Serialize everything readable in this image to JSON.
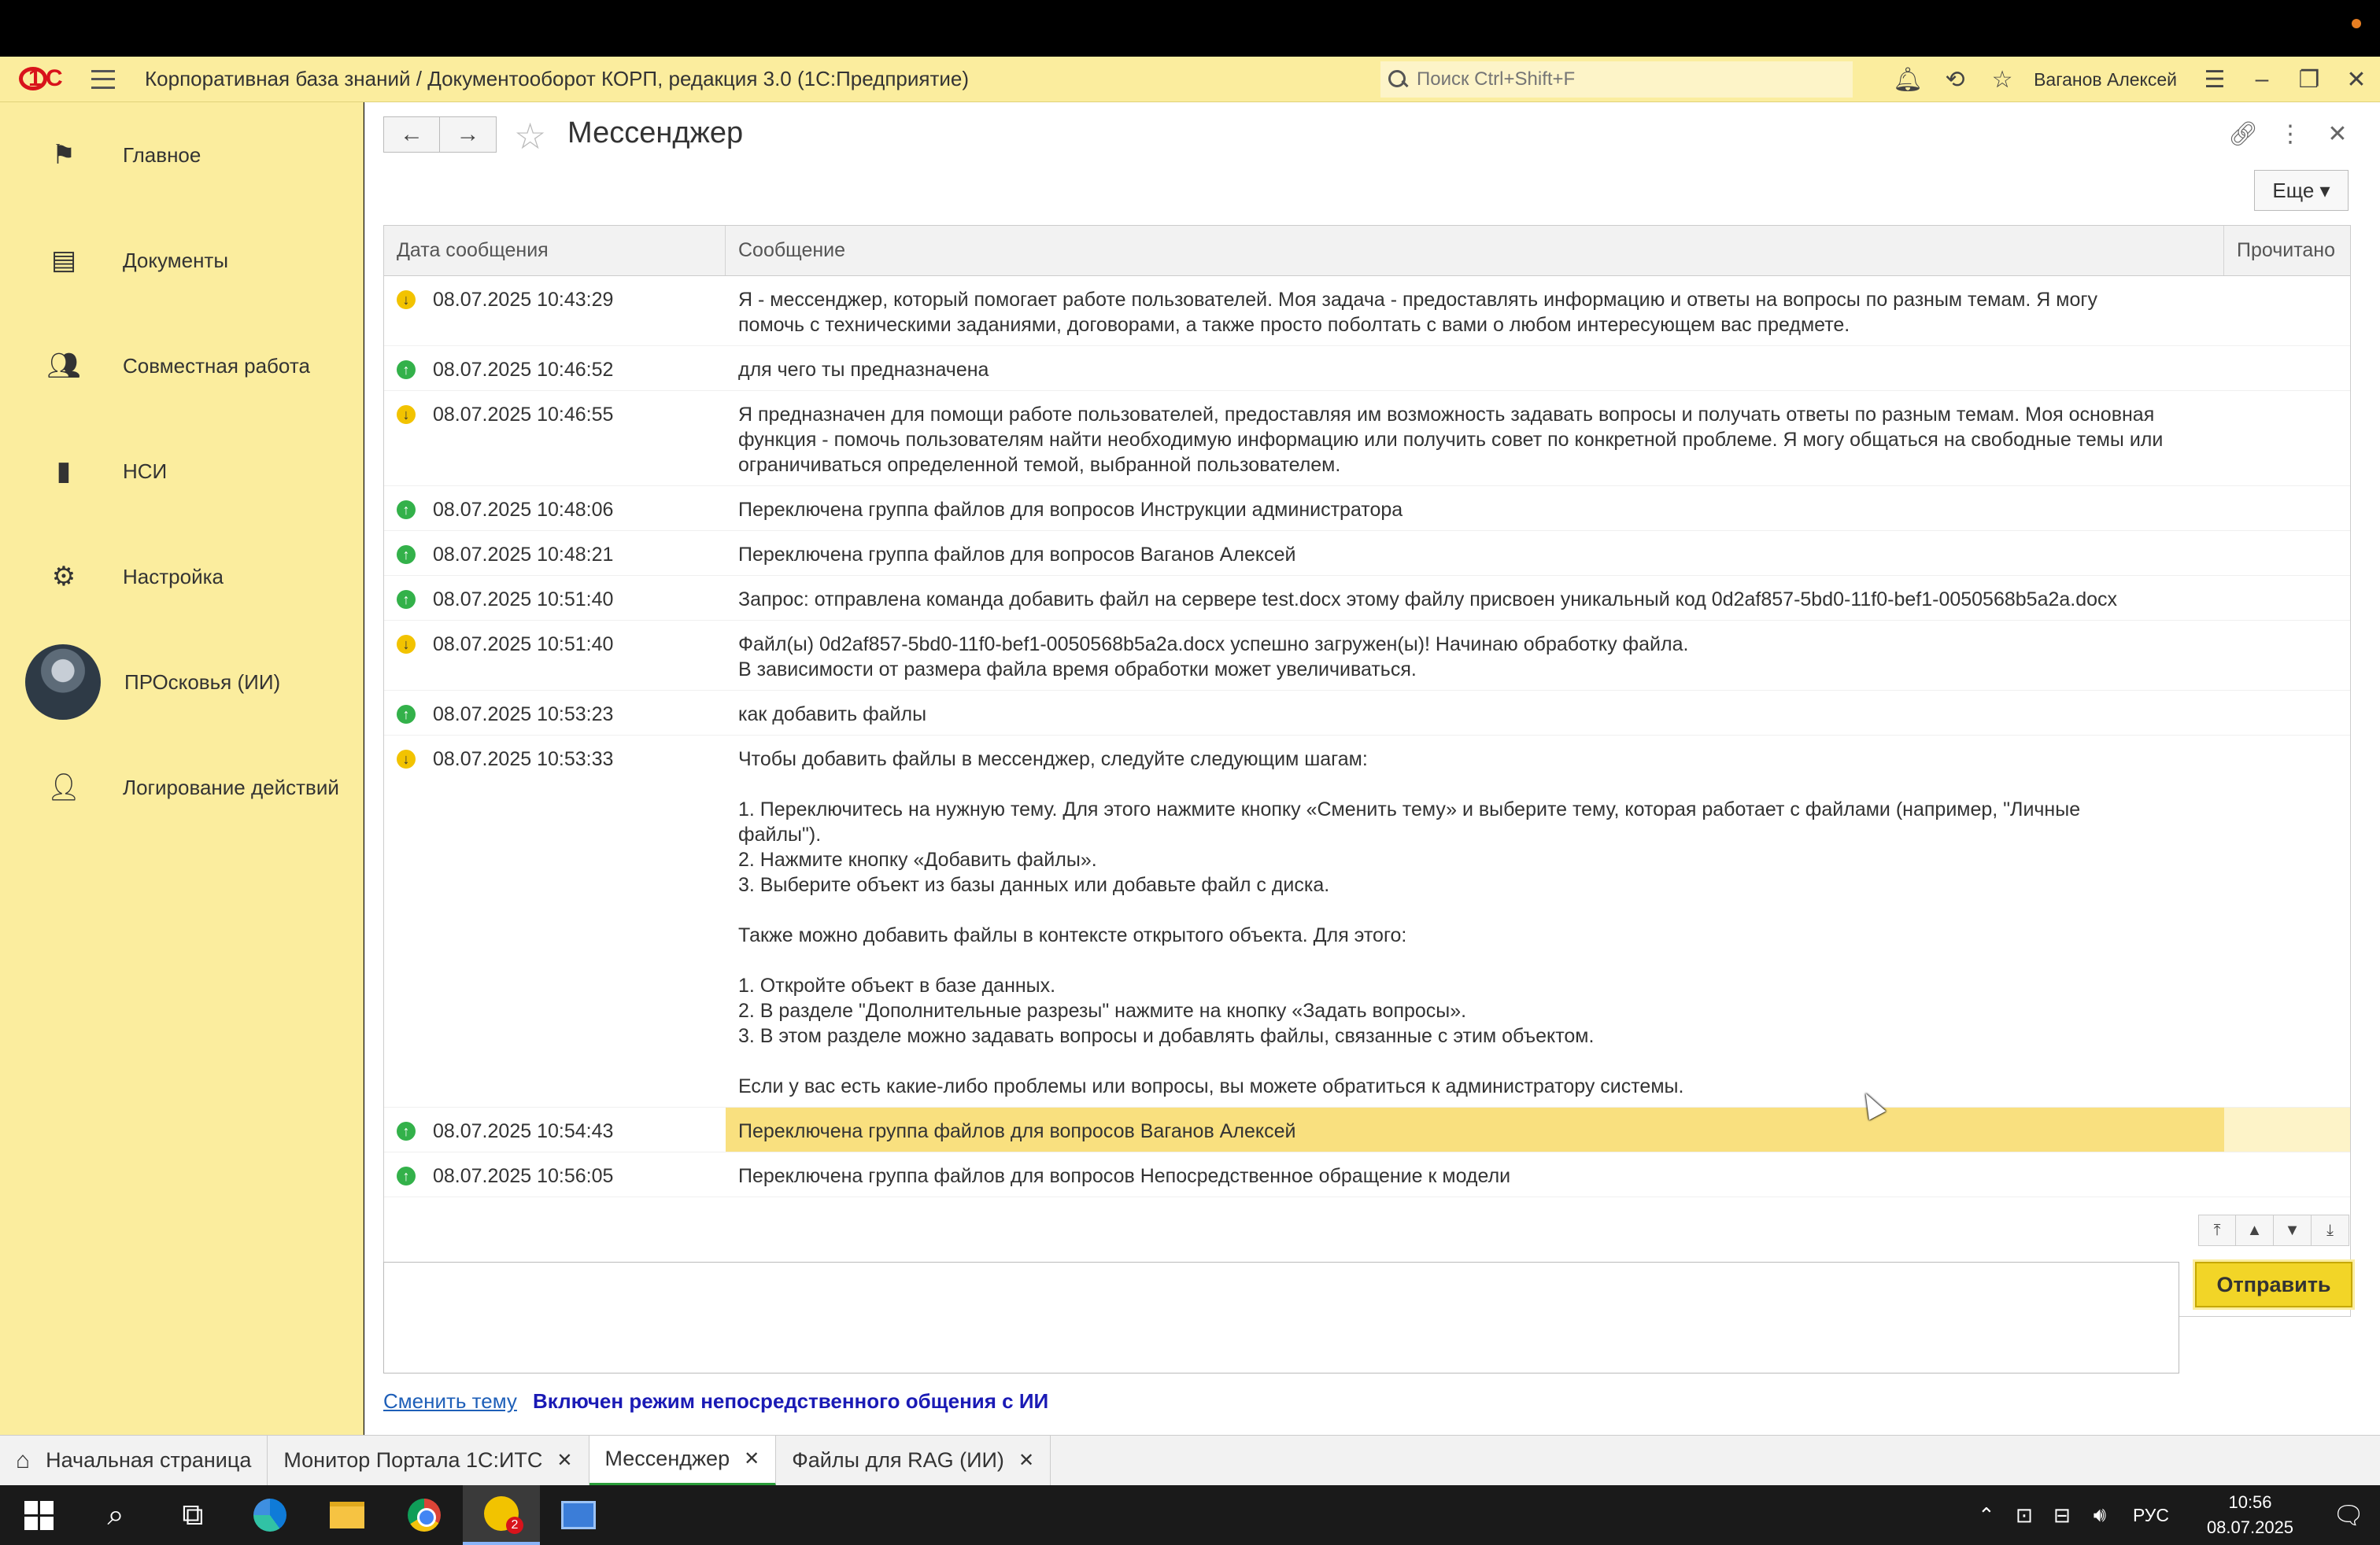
{
  "app": {
    "title": "Корпоративная база знаний / Документооборот КОРП, редакция 3.0  (1С:Предприятие)",
    "search_placeholder": "Поиск Ctrl+Shift+F",
    "user": "Ваганов Алексей"
  },
  "sidebar": {
    "items": [
      {
        "label": "Главное",
        "icon": "flag-icon"
      },
      {
        "label": "Документы",
        "icon": "documents-icon"
      },
      {
        "label": "Совместная работа",
        "icon": "people-icon"
      },
      {
        "label": "НСИ",
        "icon": "books-icon"
      },
      {
        "label": "Настройка",
        "icon": "gear-icon"
      },
      {
        "label": "ПРОсковья (ИИ)",
        "icon": "avatar"
      },
      {
        "label": "Логирование действий",
        "icon": "person-icon"
      }
    ]
  },
  "page": {
    "title": "Мессенджер",
    "more_label": "Еще"
  },
  "table": {
    "columns": [
      "Дата сообщения",
      "Сообщение",
      "Прочитано"
    ],
    "rows": [
      {
        "dir": "in",
        "date": "08.07.2025 10:43:29",
        "message": "Я - мессенджер, который помогает работе пользователей. Моя задача - предоставлять информацию и ответы на вопросы по разным темам. Я могу\nпомочь с техническими заданиями, договорами, а также просто поболтать с вами о любом интересующем вас предмете."
      },
      {
        "dir": "out",
        "date": "08.07.2025 10:46:52",
        "message": "для чего ты предназначена"
      },
      {
        "dir": "in",
        "date": "08.07.2025 10:46:55",
        "message": "Я предназначен для помощи работе пользователей, предоставляя им возможность задавать вопросы и получать ответы по разным темам. Моя основная\nфункция - помочь пользователям найти необходимую информацию или получить совет по конкретной проблеме. Я могу общаться на свободные темы или\nограничиваться определенной темой, выбранной пользователем."
      },
      {
        "dir": "out",
        "date": "08.07.2025 10:48:06",
        "message": "Переключена группа файлов для вопросов Инструкции администратора"
      },
      {
        "dir": "out",
        "date": "08.07.2025 10:48:21",
        "message": "Переключена группа файлов для вопросов Ваганов Алексей"
      },
      {
        "dir": "out",
        "date": "08.07.2025 10:51:40",
        "message": "Запрос: отправлена команда добавить файл на сервере test.docx этому файлу присвоен уникальный код 0d2af857-5bd0-11f0-bef1-0050568b5a2a.docx"
      },
      {
        "dir": "in",
        "date": "08.07.2025 10:51:40",
        "message": "Файл(ы) 0d2af857-5bd0-11f0-bef1-0050568b5a2a.docx успешно загружен(ы)! Начинаю обработку файла.\nВ зависимости от размера файла время обработки может увеличиваться."
      },
      {
        "dir": "out",
        "date": "08.07.2025 10:53:23",
        "message": "как добавить файлы"
      },
      {
        "dir": "in",
        "date": "08.07.2025 10:53:33",
        "message": "Чтобы добавить файлы в мессенджер, следуйте следующим шагам:\n\n1. Переключитесь на нужную тему. Для этого нажмите кнопку «Сменить тему» и выберите тему, которая работает с файлами (например, \"Личные\nфайлы\").\n2. Нажмите кнопку «Добавить файлы».\n3. Выберите объект из базы данных или добавьте файл с диска.\n\nТакже можно добавить файлы в контексте открытого объекта. Для этого:\n\n1. Откройте объект в базе данных.\n2. В разделе \"Дополнительные разрезы\" нажмите на кнопку «Задать вопросы».\n3. В этом разделе можно задавать вопросы и добавлять файлы, связанные с этим объектом.\n\nЕсли у вас есть какие-либо проблемы или вопросы, вы можете обратиться к администратору системы."
      },
      {
        "dir": "out",
        "date": "08.07.2025 10:54:43",
        "message": "Переключена группа файлов для вопросов Ваганов Алексей",
        "selected": true
      },
      {
        "dir": "out",
        "date": "08.07.2025 10:56:05",
        "message": "Переключена группа файлов для вопросов Непосредственное обращение к модели"
      }
    ]
  },
  "compose": {
    "send_label": "Отправить",
    "change_topic_label": "Сменить тему",
    "mode_text": "Включен режим непосредственного общения с ИИ"
  },
  "tabs": [
    {
      "label": "Начальная страница",
      "home": true
    },
    {
      "label": "Монитор Портала 1С:ИТС",
      "closable": true
    },
    {
      "label": "Мессенджер",
      "closable": true,
      "active": true
    },
    {
      "label": "Файлы для RAG (ИИ)",
      "closable": true
    }
  ],
  "taskbar": {
    "lang": "РУС",
    "time": "10:56",
    "date": "08.07.2025"
  }
}
